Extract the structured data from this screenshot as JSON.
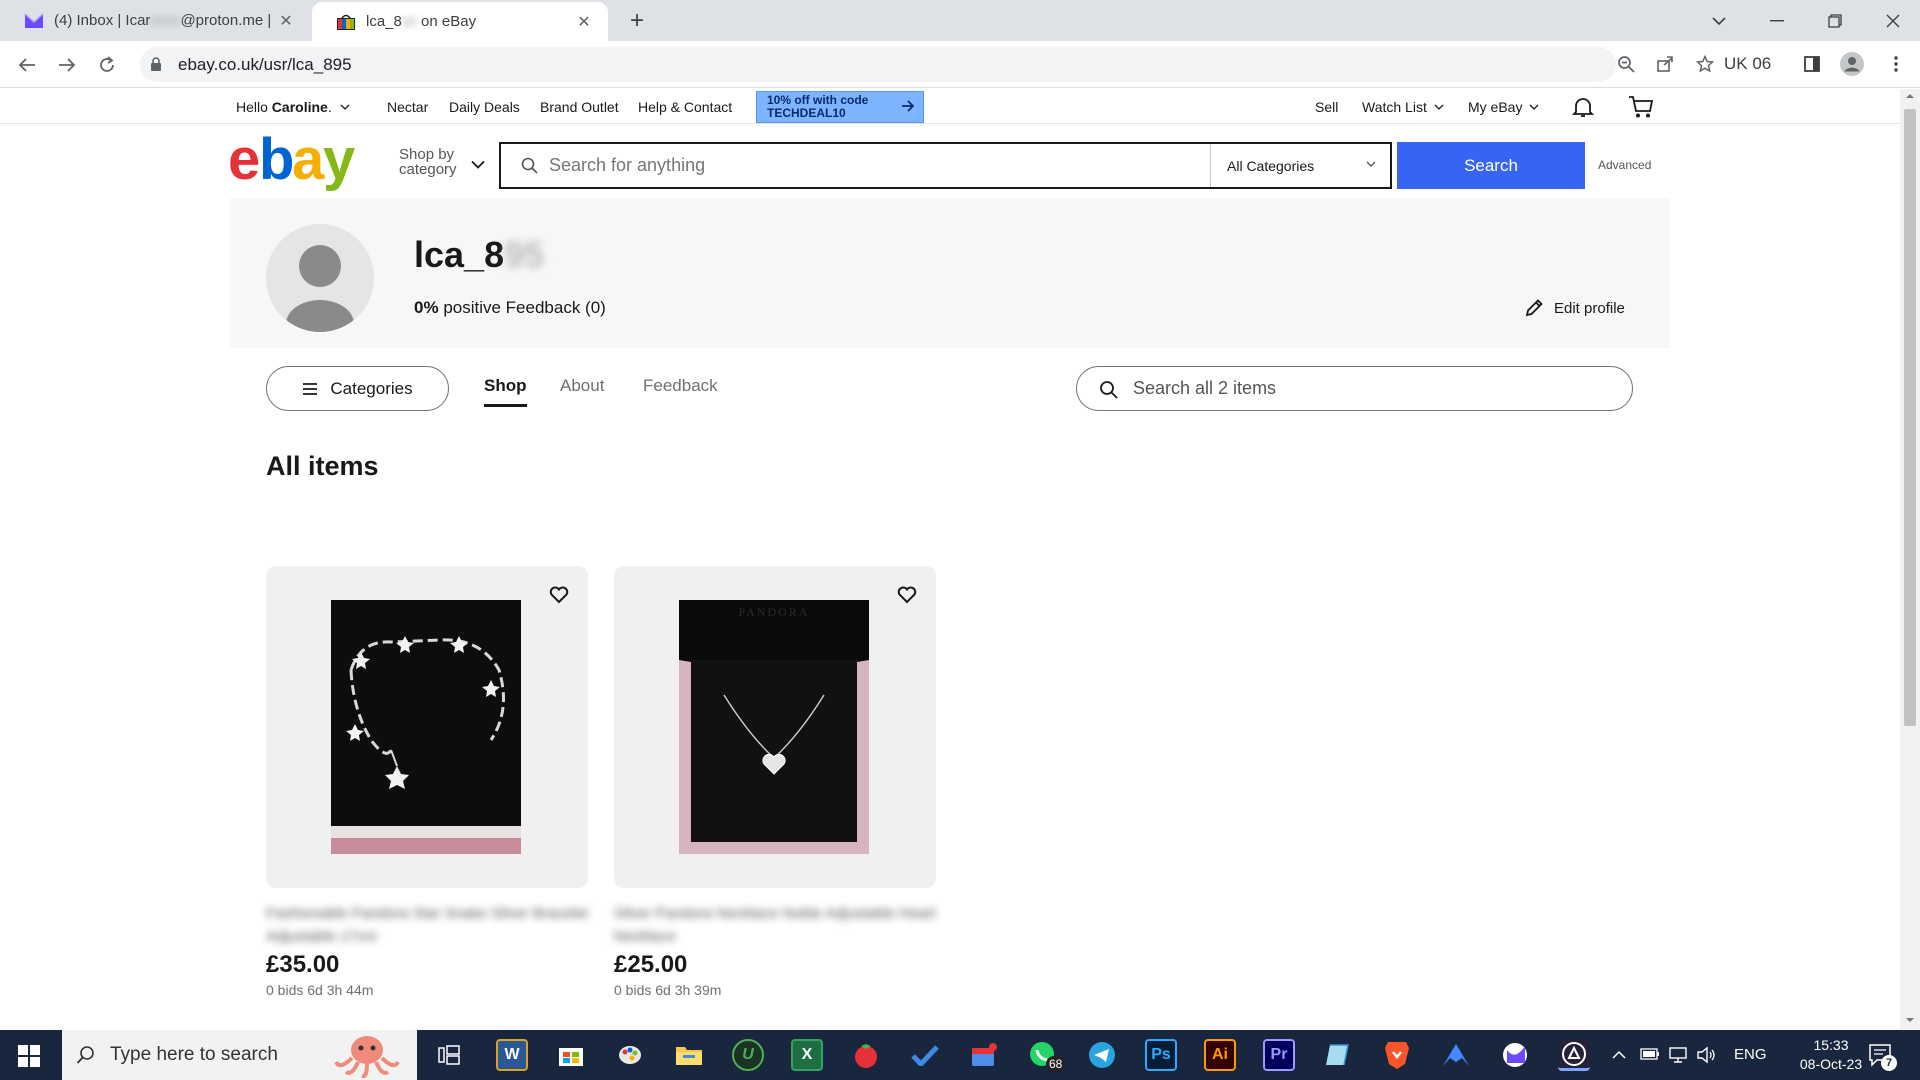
{
  "browser": {
    "tabs": [
      {
        "title_a": "(4) Inbox | Icar",
        "title_blur": "xxxx",
        "title_b": "@proton.me | P"
      },
      {
        "title_a": "lca_8",
        "title_blur": "xx",
        "title_b": " on eBay"
      }
    ],
    "url": "ebay.co.uk/usr/lca_895",
    "profile_label": "UK 06"
  },
  "topbar": {
    "hello": "Hello",
    "user": "Caroline",
    "links": [
      "Nectar",
      "Daily Deals",
      "Brand Outlet",
      "Help & Contact"
    ],
    "promo_line1": "10% off with code",
    "promo_line2": "TECHDEAL10",
    "right_links": [
      "Sell",
      "Watch List",
      "My eBay"
    ]
  },
  "header": {
    "shop_by_line1": "Shop by",
    "shop_by_line2": "category",
    "search_placeholder": "Search for anything",
    "category_selected": "All Categories",
    "search_button": "Search",
    "advanced": "Advanced"
  },
  "profile": {
    "username_visible": "lca_8",
    "username_blur": "95",
    "feedback_percent": "0%",
    "feedback_text": "positive Feedback (0)",
    "edit_profile": "Edit profile"
  },
  "store": {
    "categories_button": "Categories",
    "tabs": [
      "Shop",
      "About",
      "Feedback"
    ],
    "selected_tab": "Shop",
    "search_placeholder": "Search all 2 items",
    "section_title": "All items"
  },
  "items": [
    {
      "title": "Fashionable Pandora Star Snake Silver Bracelet Adjustable 17cm",
      "price": "£35.00",
      "bids": "0 bids 6d 3h 44m"
    },
    {
      "title": "Silver Pandora Necklace Noble Adjustable Heart Necklace",
      "price": "£25.00",
      "bids": "0 bids 6d 3h 39m"
    }
  ],
  "taskbar": {
    "search_placeholder": "Type here to search",
    "whatsapp_badge": "68",
    "language": "ENG",
    "time": "15:33",
    "date": "08-Oct-23",
    "notification_count": "7"
  },
  "colors": {
    "ebay_red": "#e53238",
    "ebay_blue": "#0064d2",
    "ebay_yellow": "#f5af02",
    "ebay_green": "#86b817",
    "search_button": "#3665f3",
    "promo": "#7db3ff"
  }
}
